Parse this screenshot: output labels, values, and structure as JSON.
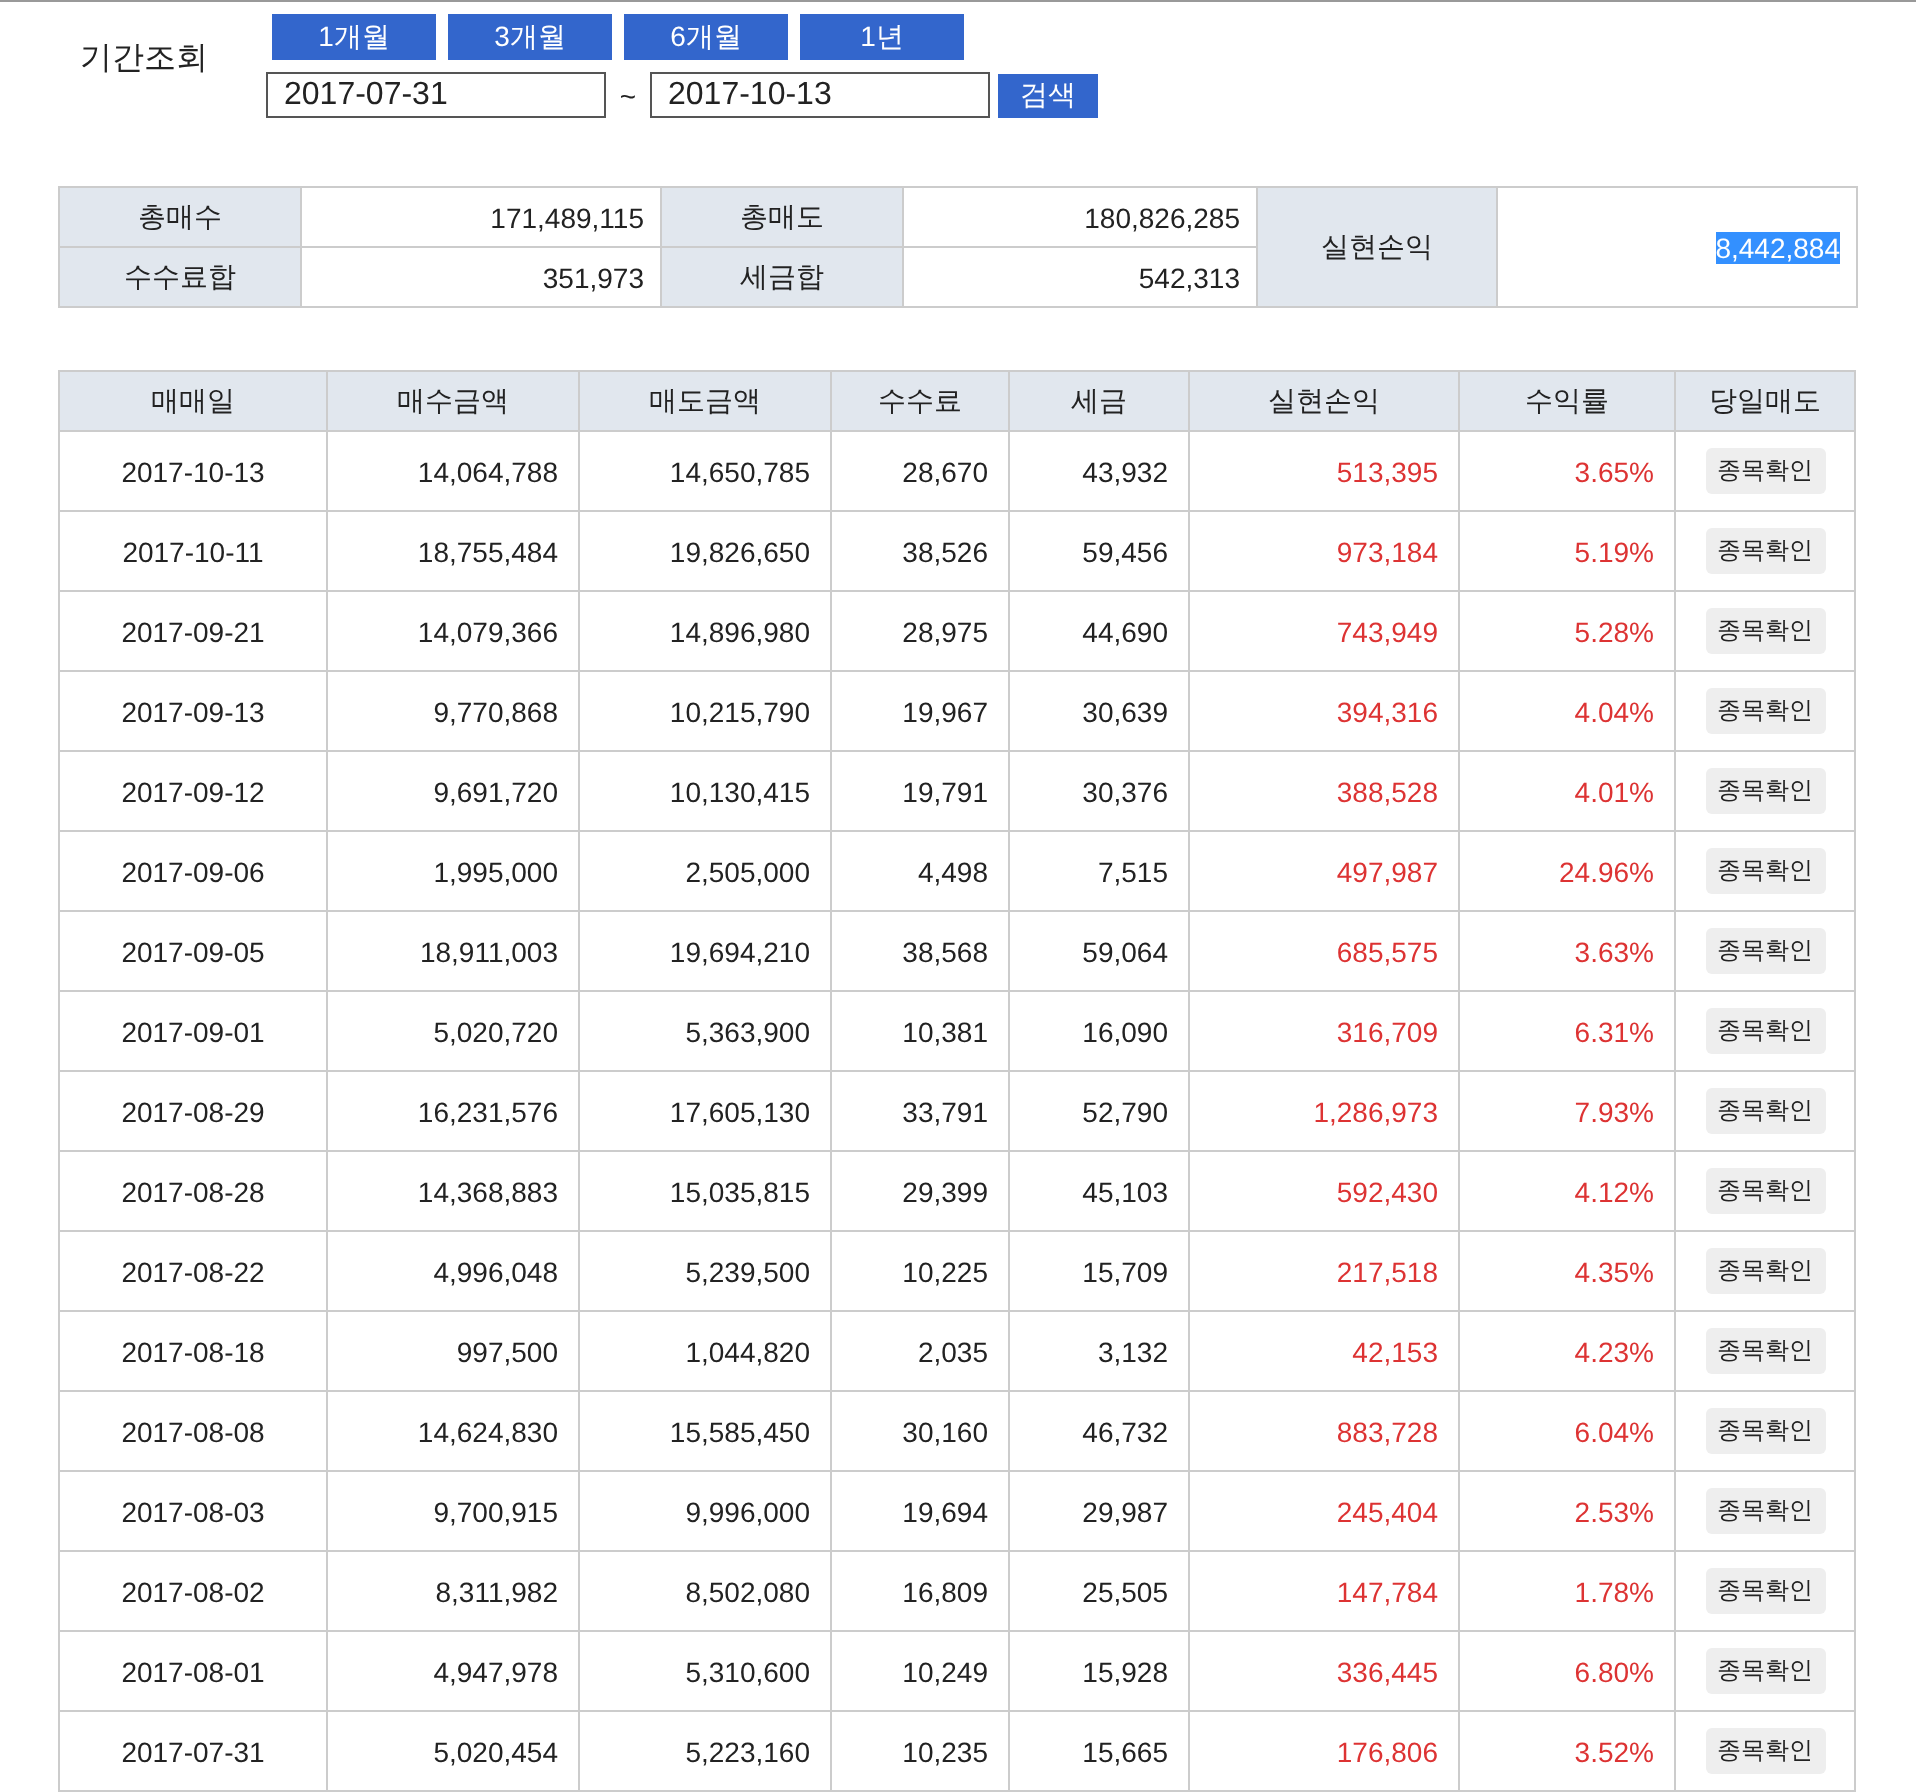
{
  "period": {
    "label": "기간조회",
    "quick_buttons": [
      "1개월",
      "3개월",
      "6개월",
      "1년"
    ],
    "start_date": "2017-07-31",
    "separator": "~",
    "end_date": "2017-10-13",
    "search_button": "검색"
  },
  "summary": {
    "total_buy_label": "총매수",
    "total_buy": "171,489,115",
    "total_sell_label": "총매도",
    "total_sell": "180,826,285",
    "fee_label": "수수료합",
    "fee": "351,973",
    "tax_label": "세금합",
    "tax": "542,313",
    "profit_label": "실현손익",
    "profit": "8,442,884",
    "profit_selected": true
  },
  "table": {
    "columns": [
      "매매일",
      "매수금액",
      "매도금액",
      "수수료",
      "세금",
      "실현손익",
      "수익률",
      "당일매도"
    ],
    "rows": [
      {
        "date": "2017-10-13",
        "buy": "14,064,788",
        "sell": "14,650,785",
        "fee": "28,670",
        "tax": "43,932",
        "profit": "513,395",
        "rate": "3.65%",
        "action": "종목확인"
      },
      {
        "date": "2017-10-11",
        "buy": "18,755,484",
        "sell": "19,826,650",
        "fee": "38,526",
        "tax": "59,456",
        "profit": "973,184",
        "rate": "5.19%",
        "action": "종목확인"
      },
      {
        "date": "2017-09-21",
        "buy": "14,079,366",
        "sell": "14,896,980",
        "fee": "28,975",
        "tax": "44,690",
        "profit": "743,949",
        "rate": "5.28%",
        "action": "종목확인"
      },
      {
        "date": "2017-09-13",
        "buy": "9,770,868",
        "sell": "10,215,790",
        "fee": "19,967",
        "tax": "30,639",
        "profit": "394,316",
        "rate": "4.04%",
        "action": "종목확인"
      },
      {
        "date": "2017-09-12",
        "buy": "9,691,720",
        "sell": "10,130,415",
        "fee": "19,791",
        "tax": "30,376",
        "profit": "388,528",
        "rate": "4.01%",
        "action": "종목확인"
      },
      {
        "date": "2017-09-06",
        "buy": "1,995,000",
        "sell": "2,505,000",
        "fee": "4,498",
        "tax": "7,515",
        "profit": "497,987",
        "rate": "24.96%",
        "action": "종목확인"
      },
      {
        "date": "2017-09-05",
        "buy": "18,911,003",
        "sell": "19,694,210",
        "fee": "38,568",
        "tax": "59,064",
        "profit": "685,575",
        "rate": "3.63%",
        "action": "종목확인"
      },
      {
        "date": "2017-09-01",
        "buy": "5,020,720",
        "sell": "5,363,900",
        "fee": "10,381",
        "tax": "16,090",
        "profit": "316,709",
        "rate": "6.31%",
        "action": "종목확인"
      },
      {
        "date": "2017-08-29",
        "buy": "16,231,576",
        "sell": "17,605,130",
        "fee": "33,791",
        "tax": "52,790",
        "profit": "1,286,973",
        "rate": "7.93%",
        "action": "종목확인"
      },
      {
        "date": "2017-08-28",
        "buy": "14,368,883",
        "sell": "15,035,815",
        "fee": "29,399",
        "tax": "45,103",
        "profit": "592,430",
        "rate": "4.12%",
        "action": "종목확인"
      },
      {
        "date": "2017-08-22",
        "buy": "4,996,048",
        "sell": "5,239,500",
        "fee": "10,225",
        "tax": "15,709",
        "profit": "217,518",
        "rate": "4.35%",
        "action": "종목확인"
      },
      {
        "date": "2017-08-18",
        "buy": "997,500",
        "sell": "1,044,820",
        "fee": "2,035",
        "tax": "3,132",
        "profit": "42,153",
        "rate": "4.23%",
        "action": "종목확인"
      },
      {
        "date": "2017-08-08",
        "buy": "14,624,830",
        "sell": "15,585,450",
        "fee": "30,160",
        "tax": "46,732",
        "profit": "883,728",
        "rate": "6.04%",
        "action": "종목확인"
      },
      {
        "date": "2017-08-03",
        "buy": "9,700,915",
        "sell": "9,996,000",
        "fee": "19,694",
        "tax": "29,987",
        "profit": "245,404",
        "rate": "2.53%",
        "action": "종목확인"
      },
      {
        "date": "2017-08-02",
        "buy": "8,311,982",
        "sell": "8,502,080",
        "fee": "16,809",
        "tax": "25,505",
        "profit": "147,784",
        "rate": "1.78%",
        "action": "종목확인"
      },
      {
        "date": "2017-08-01",
        "buy": "4,947,978",
        "sell": "5,310,600",
        "fee": "10,249",
        "tax": "15,928",
        "profit": "336,445",
        "rate": "6.80%",
        "action": "종목확인"
      },
      {
        "date": "2017-07-31",
        "buy": "5,020,454",
        "sell": "5,223,160",
        "fee": "10,235",
        "tax": "15,665",
        "profit": "176,806",
        "rate": "3.52%",
        "action": "종목확인"
      }
    ]
  }
}
